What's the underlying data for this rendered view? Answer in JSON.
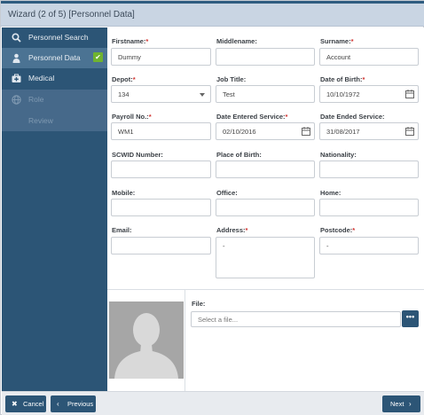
{
  "window": {
    "title": "Wizard (2 of 5) [Personnel Data]"
  },
  "sidebar": {
    "steps": [
      {
        "label": "Personnel Search",
        "icon": "search-icon"
      },
      {
        "label": "Personnel Data",
        "icon": "user-icon",
        "completed": true
      },
      {
        "label": "Medical",
        "icon": "medical-kit-icon"
      },
      {
        "label": "Role",
        "icon": "globe-icon"
      },
      {
        "label": "Review",
        "icon": ""
      }
    ]
  },
  "form": {
    "firstname": {
      "label": "Firstname:",
      "required": "*",
      "value": "Dummy"
    },
    "middlename": {
      "label": "Middlename:",
      "value": ""
    },
    "surname": {
      "label": "Surname:",
      "required": "*",
      "value": "Account"
    },
    "depot": {
      "label": "Depot:",
      "required": "*",
      "value": "134"
    },
    "job_title": {
      "label": "Job Title:",
      "value": "Test"
    },
    "dob": {
      "label": "Date of Birth:",
      "required": "*",
      "value": "10/10/1972"
    },
    "payroll": {
      "label": "Payroll No.:",
      "required": "*",
      "value": "WM1"
    },
    "date_entered": {
      "label": "Date Entered Service:",
      "required": "*",
      "value": "02/10/2016"
    },
    "date_ended": {
      "label": "Date Ended Service:",
      "value": "31/08/2017"
    },
    "scwid": {
      "label": "SCWID Number:",
      "value": ""
    },
    "place_of_birth": {
      "label": "Place of Birth:",
      "value": ""
    },
    "nationality": {
      "label": "Nationality:",
      "value": ""
    },
    "mobile": {
      "label": "Mobile:",
      "value": ""
    },
    "office": {
      "label": "Office:",
      "value": ""
    },
    "home": {
      "label": "Home:",
      "value": ""
    },
    "email": {
      "label": "Email:",
      "value": ""
    },
    "address": {
      "label": "Address:",
      "required": "*",
      "value": "-"
    },
    "postcode": {
      "label": "Postcode:",
      "required": "*",
      "value": "-"
    }
  },
  "file": {
    "label": "File:",
    "placeholder": "Select a file...",
    "browse_label": "•••"
  },
  "footer": {
    "cancel_label": "Cancel",
    "previous_label": "Previous",
    "next_label": "Next"
  },
  "colors": {
    "primary": "#2c5576",
    "title_bar": "#c9d5e3",
    "required": "#d0302d",
    "check": "#6fb32f"
  }
}
